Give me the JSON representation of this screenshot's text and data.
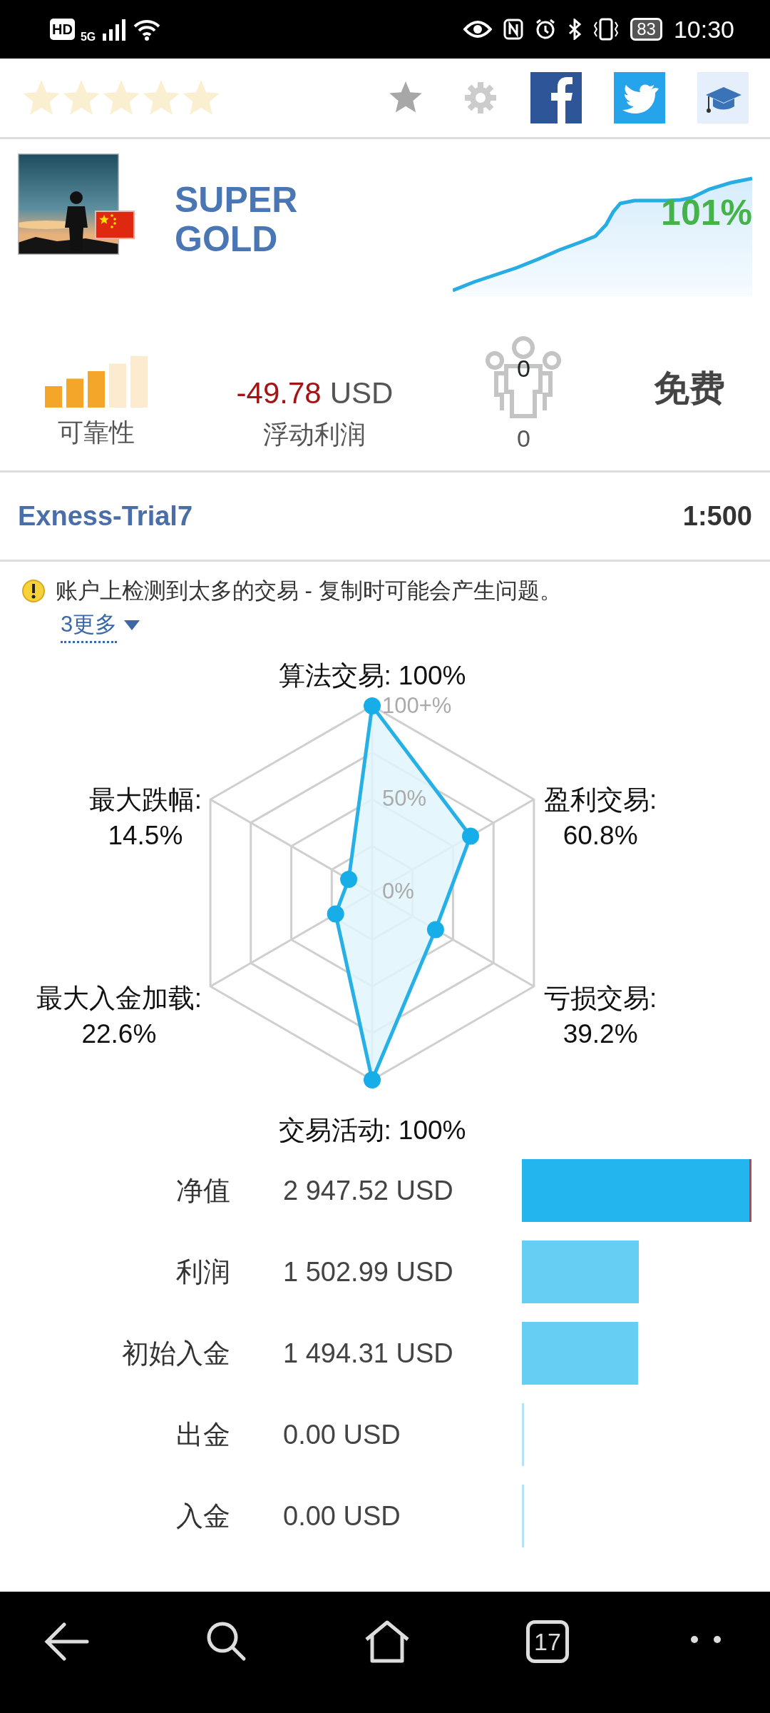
{
  "status_bar": {
    "left": [
      "HD",
      "5G"
    ],
    "battery": "83",
    "time": "10:30"
  },
  "signal": {
    "title": "SUPER GOLD",
    "growth": "101%"
  },
  "stats": {
    "reliability": {
      "level": 0.6,
      "label": "可靠性"
    },
    "floating_profit": {
      "amount": "-49.78",
      "currency": "USD",
      "label": "浮动利润"
    },
    "subscribers": {
      "icon_count": "0",
      "count": "0"
    },
    "price": "免费"
  },
  "account": {
    "server": "Exness-Trial7",
    "leverage": "1:500"
  },
  "warning": {
    "text": "账户上检测到太多的交易 - 复制时可能会产生问题。",
    "more_link": "3更多"
  },
  "radar": {
    "ring_labels": [
      "100+%",
      "50%",
      "0%"
    ],
    "axes": [
      {
        "name": "算法交易:",
        "value": "100%"
      },
      {
        "name": "最大跌幅:",
        "value": "14.5%"
      },
      {
        "name": "盈利交易:",
        "value": "60.8%"
      },
      {
        "name": "最大入金加载:",
        "value": "22.6%"
      },
      {
        "name": "亏损交易:",
        "value": "39.2%"
      },
      {
        "name": "交易活动:",
        "value": "100%"
      }
    ]
  },
  "balances": [
    {
      "label": "净值",
      "value": "2 947.52 USD",
      "color": "#22b5ee"
    },
    {
      "label": "利润",
      "value": "1 502.99 USD",
      "color": "#66cdf3"
    },
    {
      "label": "初始入金",
      "value": "1 494.31 USD",
      "color": "#66cdf3"
    },
    {
      "label": "出金",
      "value": "0.00 USD",
      "color": "#b5e3f5"
    },
    {
      "label": "入金",
      "value": "0.00 USD",
      "color": "#b5e3f5"
    }
  ],
  "nav_bar": {
    "recent_count": "17"
  }
}
